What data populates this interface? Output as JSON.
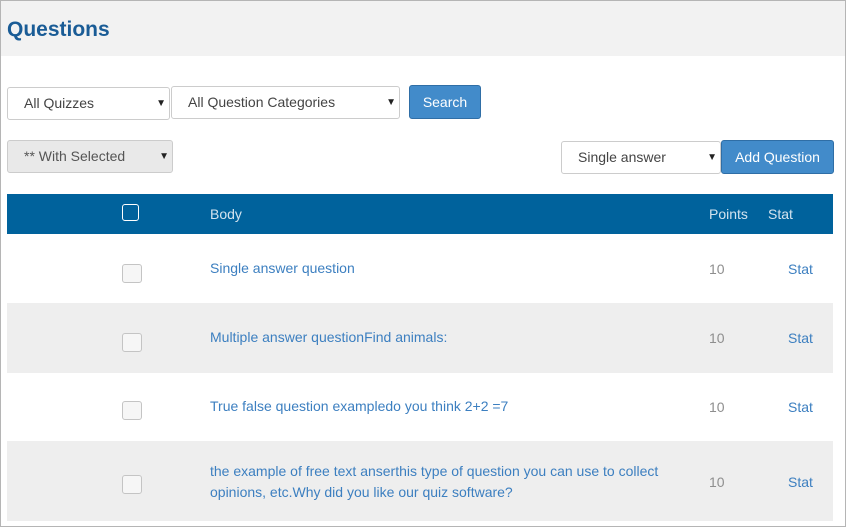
{
  "page": {
    "title": "Questions"
  },
  "filters": {
    "quiz_select": "All Quizzes",
    "category_select": "All Question Categories",
    "search_button": "Search",
    "bulk_select": "** With Selected",
    "type_select": "Single answer",
    "add_button": "Add Question"
  },
  "table": {
    "headers": {
      "body": "Body",
      "points": "Points",
      "stat": "Stat"
    },
    "rows": [
      {
        "body": "Single answer question",
        "points": "10",
        "stat": "Stat"
      },
      {
        "body": "Multiple answer questionFind animals:",
        "points": "10",
        "stat": "Stat"
      },
      {
        "body": "True false question exampledo you think 2+2 =7",
        "points": "10",
        "stat": "Stat"
      },
      {
        "body": "the example of free text anserthis type of question you can use to collect opinions, etc.Why did you like our quiz software?",
        "points": "10",
        "stat": "Stat"
      }
    ]
  },
  "colors": {
    "title": "#1a5c96",
    "header_bar": "#00629c",
    "button": "#428bca",
    "link": "#3c7fc0"
  },
  "icons": {
    "dropdown": "caret-down-icon"
  }
}
